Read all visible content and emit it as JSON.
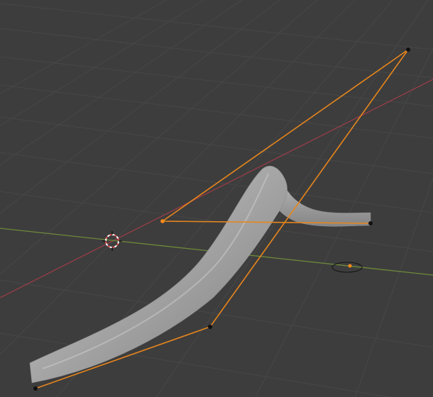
{
  "viewport": {
    "editor": "3D Viewport",
    "background_color": "#3d3d3d",
    "grid_color": "#4a4a4a",
    "axis_x_color": "#963d47",
    "axis_y_color": "#6e8a3a",
    "control_polygon_color": "#e8861c",
    "control_point_color": "#111111",
    "selected_point_color": "#ff8c1a",
    "curve_mesh_color": "#a6a6a6",
    "cursor_colors": [
      "#e04a4a",
      "#ffffff"
    ]
  }
}
